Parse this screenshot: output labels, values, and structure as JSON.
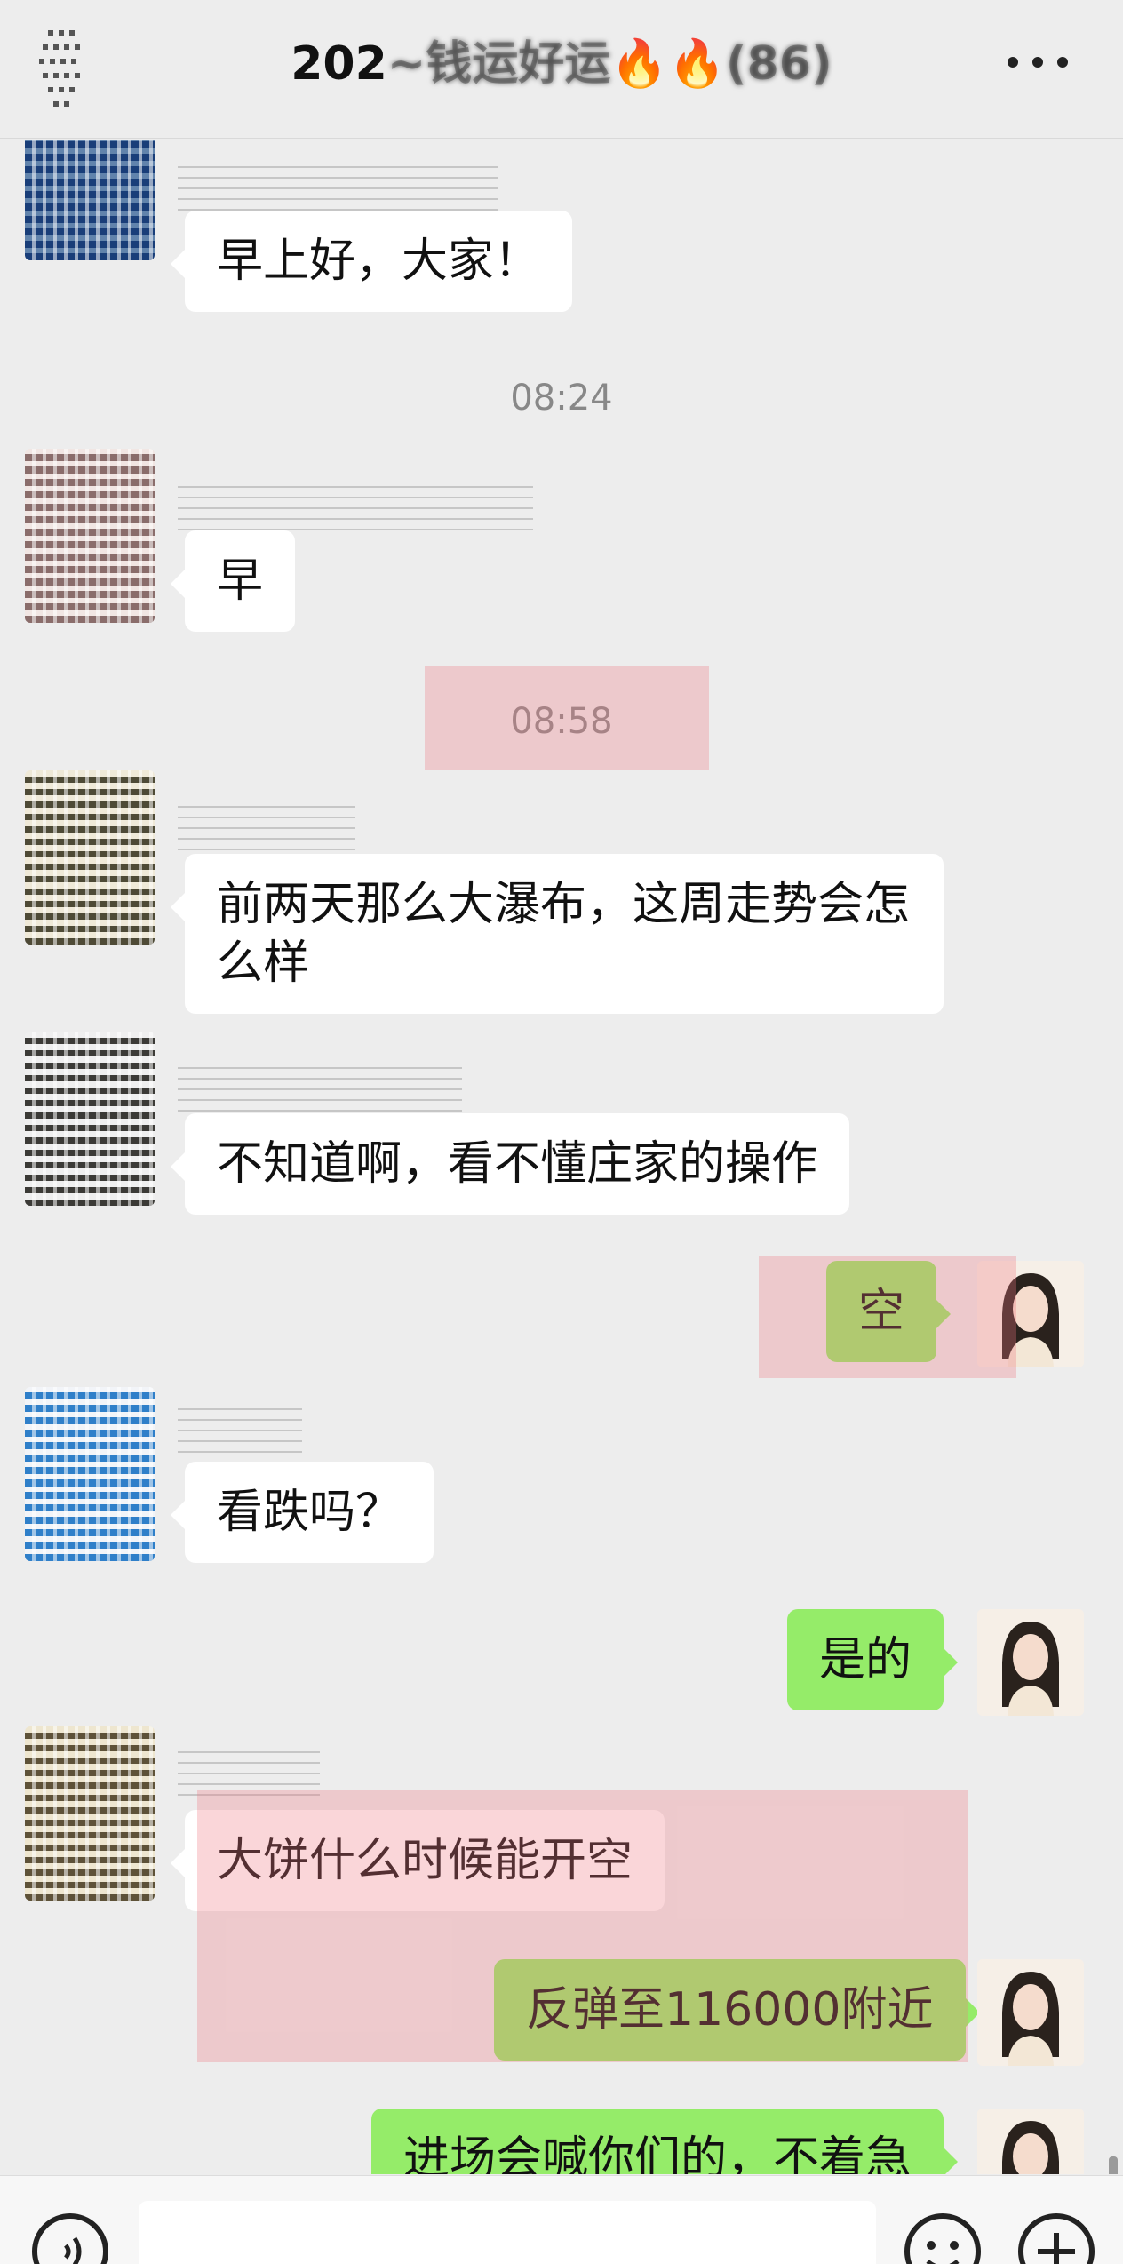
{
  "header": {
    "title_prefix": "202",
    "title_obscured": "~钱运好运",
    "title_emoji": "🔥🔥",
    "title_suffix": "(86)"
  },
  "messages": [
    {
      "type": "text",
      "side": "in",
      "text": "早上好，大家！"
    },
    {
      "type": "time",
      "text": "08:24"
    },
    {
      "type": "text",
      "side": "in",
      "text": "早"
    },
    {
      "type": "time",
      "text": "08:58"
    },
    {
      "type": "text",
      "side": "in",
      "text": "前两天那么大瀑布，这周走势会怎么样"
    },
    {
      "type": "text",
      "side": "in",
      "text": "不知道啊，看不懂庄家的操作"
    },
    {
      "type": "text",
      "side": "out",
      "text": "空"
    },
    {
      "type": "text",
      "side": "in",
      "text": "看跌吗？"
    },
    {
      "type": "text",
      "side": "out",
      "text": "是的"
    },
    {
      "type": "text",
      "side": "in",
      "text": "大饼什么时候能开空"
    },
    {
      "type": "text",
      "side": "out",
      "text": "反弹至116000附近"
    },
    {
      "type": "text",
      "side": "out",
      "text": "进场会喊你们的，不着急"
    }
  ],
  "icons": {
    "back": "back-arrow-icon",
    "more": "more-dots-icon",
    "voice": "voice-icon",
    "emoji": "emoji-icon",
    "plus": "plus-icon"
  },
  "colors": {
    "background": "#ededed",
    "incoming_bubble": "#ffffff",
    "outgoing_bubble": "#95ec69",
    "timestamp": "#888888",
    "highlight": "#f07882"
  }
}
